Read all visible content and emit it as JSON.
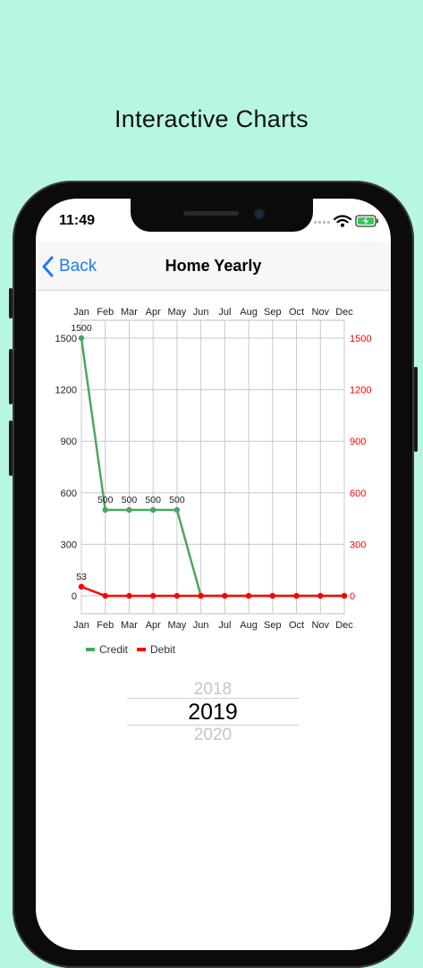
{
  "promo": {
    "title": "Interactive Charts"
  },
  "status": {
    "time": "11:49"
  },
  "navbar": {
    "back_label": "Back",
    "title": "Home Yearly"
  },
  "chart_data": {
    "type": "line",
    "categories": [
      "Jan",
      "Feb",
      "Mar",
      "Apr",
      "May",
      "Jun",
      "Jul",
      "Aug",
      "Sep",
      "Oct",
      "Nov",
      "Dec"
    ],
    "series": [
      {
        "name": "Credit",
        "axis": "left",
        "color": "#4da660",
        "values": [
          1500,
          500,
          500,
          500,
          500,
          0,
          0,
          0,
          0,
          0,
          0,
          0
        ],
        "data_labels": [
          "1500",
          "500",
          "500",
          "500",
          "500",
          "",
          "",
          "",
          "",
          "",
          "",
          ""
        ]
      },
      {
        "name": "Debit",
        "axis": "right",
        "color": "#ff0000",
        "values": [
          53,
          0,
          0,
          0,
          0,
          0,
          0,
          0,
          0,
          0,
          0,
          0
        ],
        "data_labels": [
          "53",
          "",
          "",
          "",
          "",
          "",
          "",
          "",
          "",
          "",
          "",
          ""
        ]
      }
    ],
    "ylim": [
      -100,
      1650
    ],
    "left_ticks": [
      "0",
      "300",
      "600",
      "900",
      "1200",
      "1500"
    ],
    "right_ticks": [
      "0",
      "300",
      "600",
      "900",
      "1200",
      "1500"
    ],
    "right_axis_color": "#ff0000",
    "xlabel": "",
    "ylabel": "",
    "grid": true,
    "x_labels_top_and_bottom": true,
    "legend_position": "bottom-left"
  },
  "picker": {
    "prev": "2018",
    "selected": "2019",
    "next": "2020"
  }
}
